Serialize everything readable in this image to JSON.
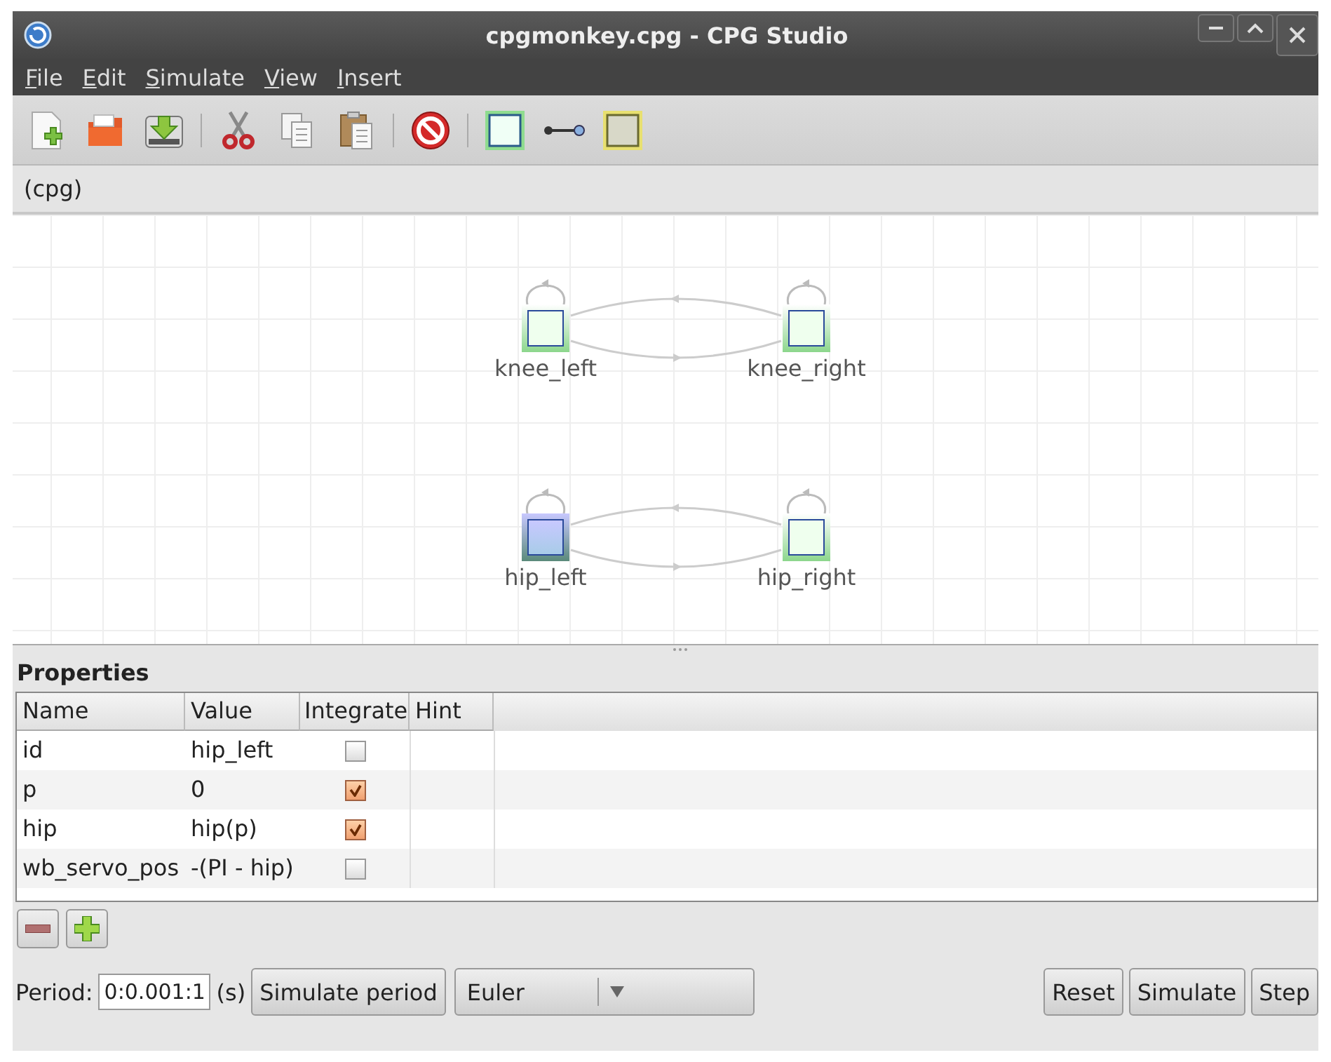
{
  "window": {
    "title": "cpgmonkey.cpg - CPG Studio"
  },
  "menu": [
    "File",
    "Edit",
    "Simulate",
    "View",
    "Insert"
  ],
  "breadcrumb": "(cpg)",
  "canvas": {
    "nodes": [
      {
        "label": "knee_left",
        "selected": false
      },
      {
        "label": "knee_right",
        "selected": false
      },
      {
        "label": "hip_left",
        "selected": true
      },
      {
        "label": "hip_right",
        "selected": false
      }
    ]
  },
  "properties": {
    "title": "Properties",
    "columns": [
      "Name",
      "Value",
      "Integrate",
      "Hint"
    ],
    "rows": [
      {
        "name": "id",
        "value": "hip_left",
        "integrate": false
      },
      {
        "name": "p",
        "value": "0",
        "integrate": true
      },
      {
        "name": "hip",
        "value": "hip(p)",
        "integrate": true
      },
      {
        "name": "wb_servo_pos",
        "value": "-(PI - hip)",
        "integrate": false
      }
    ]
  },
  "bottom_bar": {
    "period_label": "Period:",
    "period_value": "0:0.001:1",
    "unit": "(s)",
    "simulate_period": "Simulate period",
    "integrator": "Euler",
    "buttons": [
      "Reset",
      "Simulate",
      "Step"
    ]
  }
}
